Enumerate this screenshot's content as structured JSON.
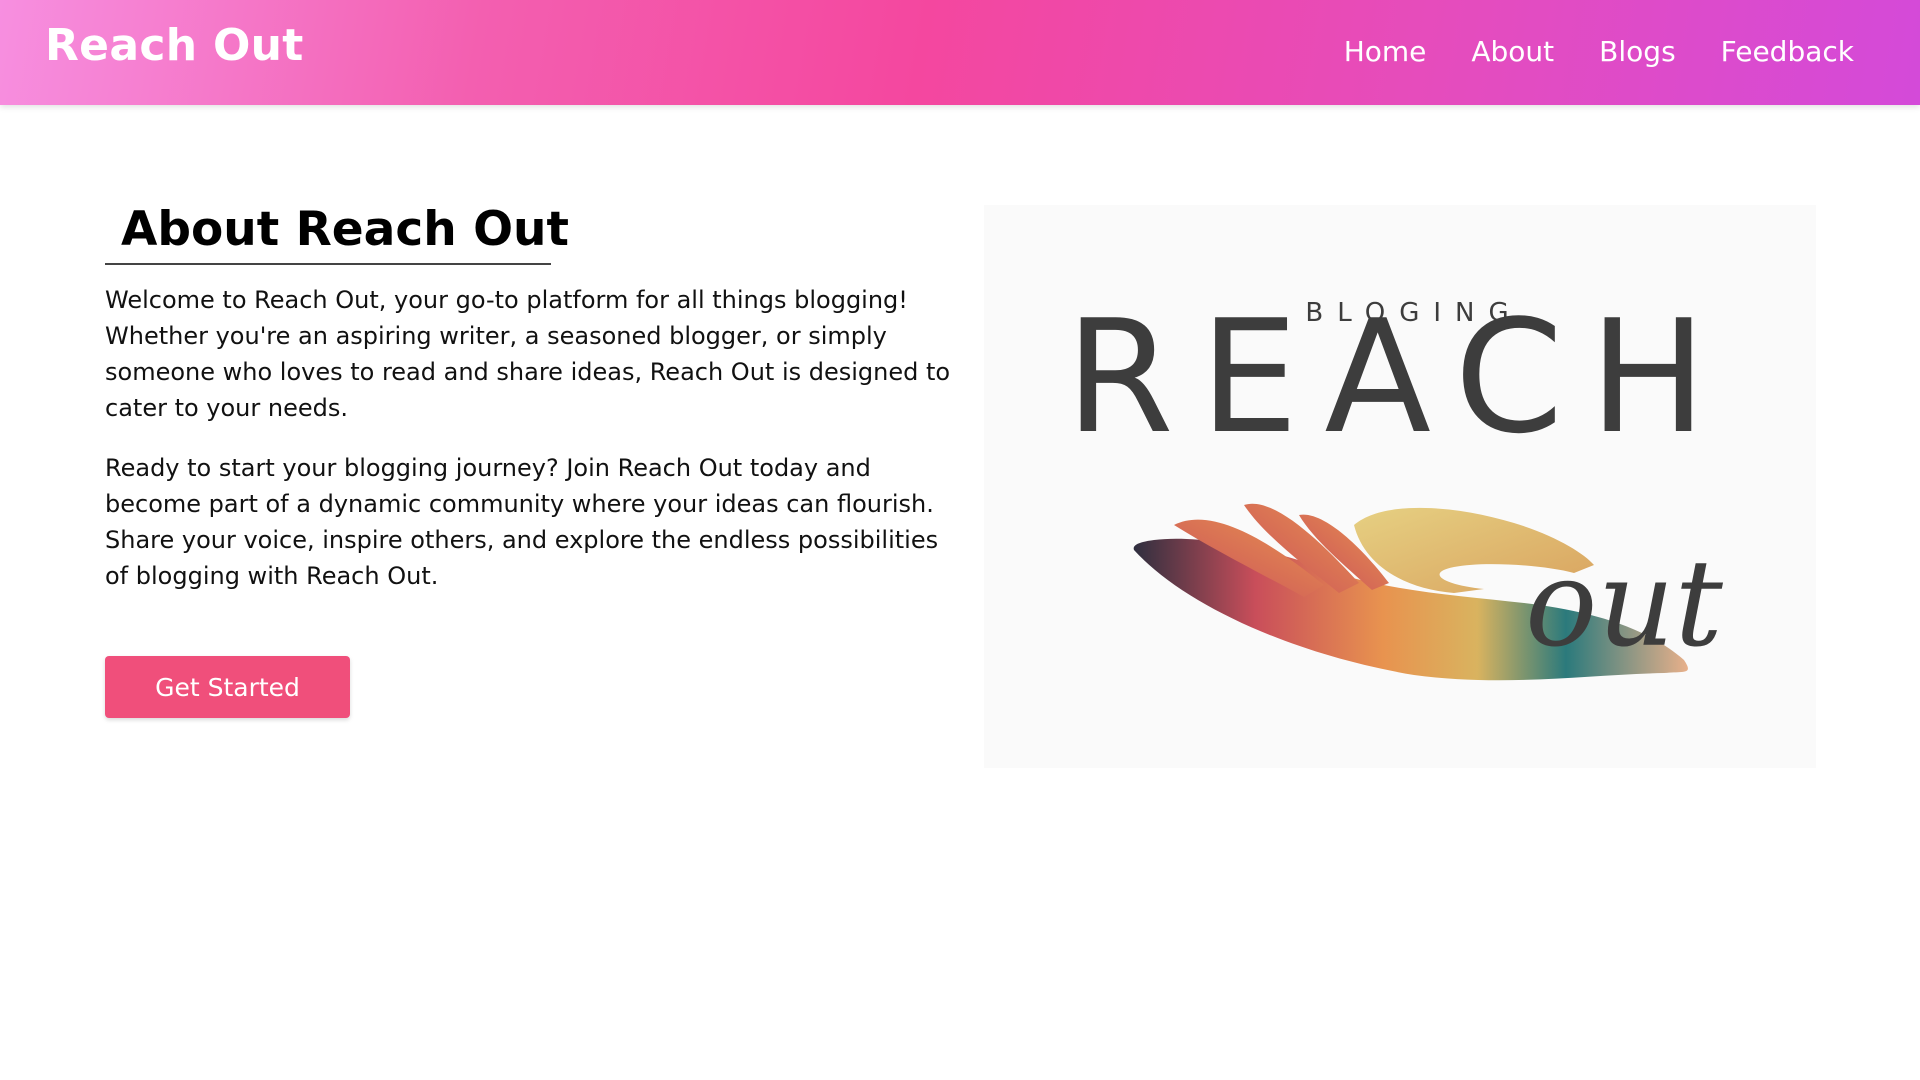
{
  "navbar": {
    "brand": "Reach Out",
    "links": [
      "Home",
      "About",
      "Blogs",
      "Feedback"
    ]
  },
  "about": {
    "heading": "About Reach Out",
    "paragraph_1": "Welcome to Reach Out, your go-to platform for all things blogging! Whether you're an aspiring writer, a seasoned blogger, or simply someone who loves to read and share ideas, Reach Out is designed to cater to your needs.",
    "paragraph_2": "Ready to start your blogging journey? Join Reach Out today and become part of a dynamic community where your ideas can flourish. Share your voice, inspire others, and explore the endless possibilities of blogging with Reach Out.",
    "cta_label": "Get Started"
  },
  "logo": {
    "top_text": "BLOGING",
    "main_text": "REACH",
    "script_text": "out"
  },
  "colors": {
    "nav_gradient": [
      "#f78fe0",
      "#f4479f",
      "#d44ad9"
    ],
    "cta": "#f04f7b",
    "logo_text": "#3d3d3d"
  }
}
